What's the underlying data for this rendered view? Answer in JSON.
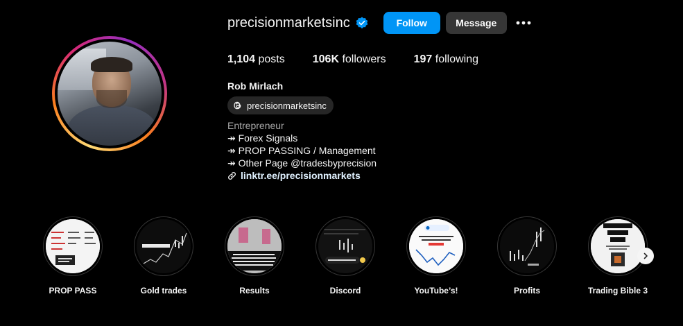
{
  "profile": {
    "username": "precisionmarketsinc",
    "full_name": "Rob Mirlach",
    "threads_handle": "precisionmarketsinc",
    "category": "Entrepreneur",
    "bio_lines": [
      "↠ Forex Signals",
      "↠ PROP PASSING / Management",
      "↠ Other Page @tradesbyprecision"
    ],
    "link": "linktr.ee/precisionmarkets"
  },
  "actions": {
    "follow_label": "Follow",
    "message_label": "Message"
  },
  "stats": {
    "posts_count": "1,104",
    "posts_label": "posts",
    "followers_count": "106K",
    "followers_label": "followers",
    "following_count": "197",
    "following_label": "following"
  },
  "highlights": [
    {
      "label": "PROP PASS"
    },
    {
      "label": "Gold trades"
    },
    {
      "label": "Results"
    },
    {
      "label": "Discord"
    },
    {
      "label": "YouTube’s!"
    },
    {
      "label": "Profits"
    },
    {
      "label": "Trading Bible 3"
    }
  ],
  "colors": {
    "follow_button": "#0095f6",
    "message_button": "#363636",
    "verified_badge": "#0095f6",
    "background": "#000000"
  },
  "icons": {
    "verified": "verified-badge-icon",
    "more": "more-options-icon",
    "threads": "threads-icon",
    "link": "link-icon",
    "next": "chevron-right-icon"
  }
}
